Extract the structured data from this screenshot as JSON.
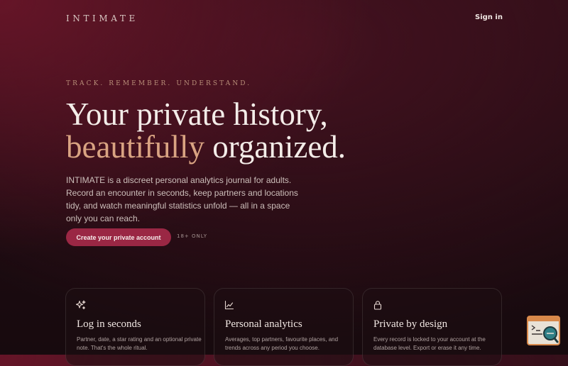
{
  "header": {
    "brand": "INTIMATE",
    "signin_label": "Sign in"
  },
  "hero": {
    "eyebrow": "TRACK. REMEMBER. UNDERSTAND.",
    "headline_line1": "Your private history,",
    "headline_accent": "beautifully",
    "headline_rest": " organized.",
    "description": "INTIMATE is a discreet personal analytics journal for adults. Record an encounter in seconds, keep partners and locations tidy, and watch meaningful statistics unfold — all in a space only you can reach.",
    "cta_label": "Create your private account",
    "age_note": "18+ ONLY"
  },
  "features": [
    {
      "icon": "sparkles-icon",
      "title": "Log in seconds",
      "description": "Partner, date, a star rating and an optional private note. That's the whole ritual."
    },
    {
      "icon": "chart-line-icon",
      "title": "Personal analytics",
      "description": "Averages, top partners, favourite places, and trends across any period you choose."
    },
    {
      "icon": "lock-icon",
      "title": "Private by design",
      "description": "Every record is locked to your account at the database level. Export or erase it any time."
    }
  ],
  "colors": {
    "accent": "#d9a382",
    "cta": "#9a2744",
    "background": "#1d0b11"
  }
}
